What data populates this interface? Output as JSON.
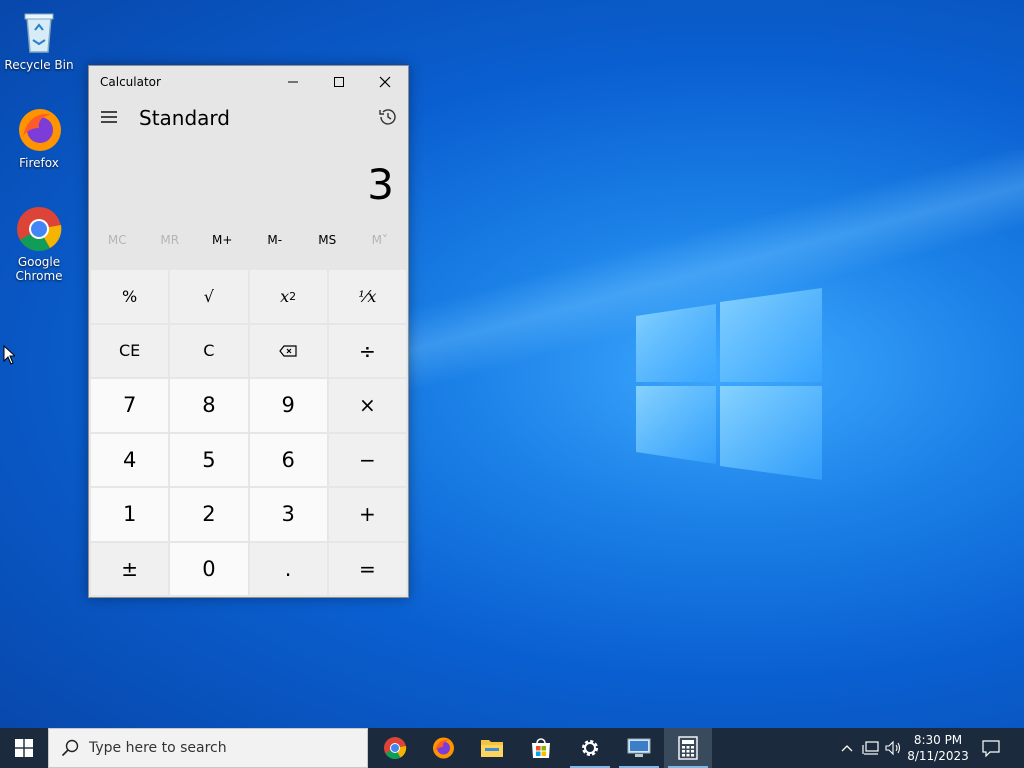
{
  "desktop": {
    "icons": [
      {
        "label": "Recycle Bin"
      },
      {
        "label": "Firefox"
      },
      {
        "label": "Google Chrome"
      }
    ]
  },
  "calculator": {
    "window_title": "Calculator",
    "mode": "Standard",
    "display_value": "3",
    "memory": [
      "MC",
      "MR",
      "M+",
      "M-",
      "MS",
      "M˅"
    ],
    "keys": {
      "percent": "%",
      "sqrt": "√",
      "square_base": "x",
      "square_exp": "2",
      "reciprocal": "⅟x",
      "ce": "CE",
      "c": "C",
      "divide": "÷",
      "seven": "7",
      "eight": "8",
      "nine": "9",
      "multiply": "×",
      "four": "4",
      "five": "5",
      "six": "6",
      "minus": "−",
      "one": "1",
      "two": "2",
      "three": "3",
      "plus": "+",
      "negate": "±",
      "zero": "0",
      "decimal": ".",
      "equals": "="
    }
  },
  "taskbar": {
    "search_placeholder": "Type here to search",
    "apps": [
      "chrome-icon",
      "firefox-icon",
      "file-explorer-icon",
      "store-icon",
      "settings-icon",
      "remote-desktop-icon",
      "calculator-icon"
    ],
    "clock_time": "8:30 PM",
    "clock_date": "8/11/2023"
  },
  "colors": {
    "taskbar": "#1b2a3c",
    "calc_bg": "#e6e6e6",
    "desktop_blue": "#0a5fd0"
  }
}
